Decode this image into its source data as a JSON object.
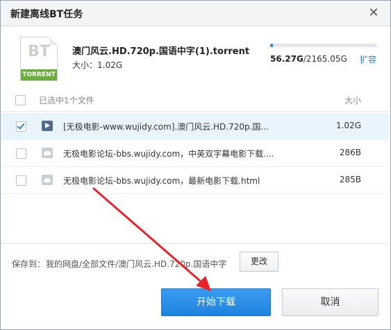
{
  "dialog": {
    "title": "新建离线BT任务",
    "close_icon": "close-icon"
  },
  "torrent": {
    "icon_label": "BT",
    "icon_band": "TORRENT",
    "filename": "澳门风云.HD.720p.国语中字(1).torrent",
    "size_text": "大小：1.02G"
  },
  "quota": {
    "used": "56.27G",
    "total": "/2165.05G",
    "used_fraction": 0.026,
    "expand_label": "扩容",
    "color": "#2e8be6"
  },
  "list": {
    "header_text": "已选中1个文件",
    "header_size": "大小",
    "rows": [
      {
        "name": "[无极电影-www.wujidy.com].澳门风云.HD.720p.国...",
        "size": "1.02G",
        "checked": true,
        "icon": "video-file-icon"
      },
      {
        "name": "无极电影论坛-bbs.wujidy.com，中英双字幕电影下载....",
        "size": "286B",
        "checked": false,
        "icon": "web-file-icon"
      },
      {
        "name": "无极电影论坛-bbs.wujidy.com，最新电影下载.html",
        "size": "285B",
        "checked": false,
        "icon": "web-file-icon"
      }
    ]
  },
  "save": {
    "label": "保存到：",
    "path": "我的网盘/全部文件/澳门风云.HD.720p.国语中字",
    "change_label": "更改"
  },
  "buttons": {
    "start_label": "开始下载",
    "cancel_label": "取消"
  },
  "annotation": {
    "color": "#e8232a"
  }
}
